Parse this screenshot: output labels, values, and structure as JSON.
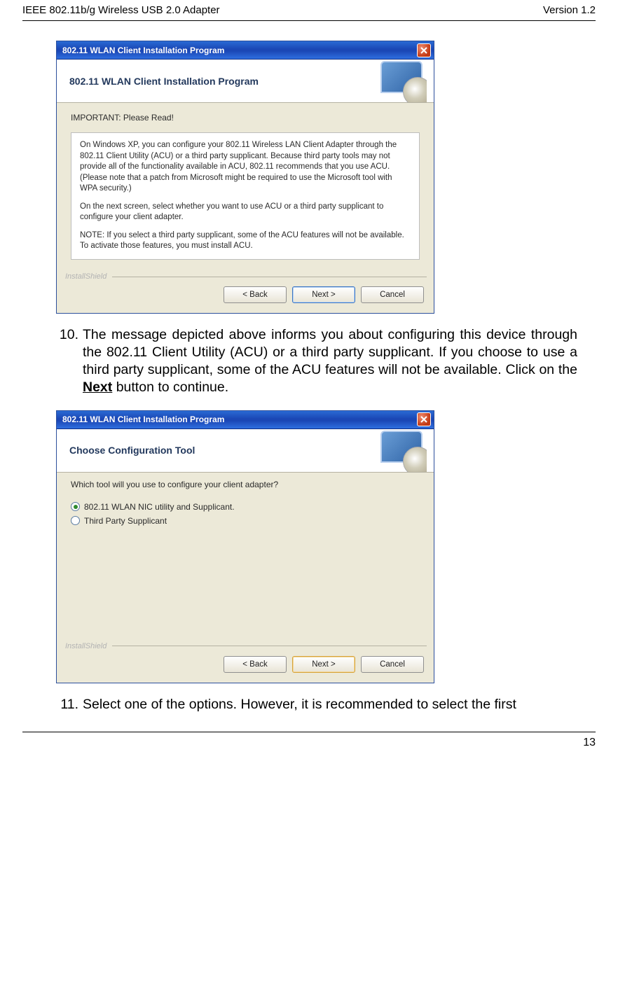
{
  "header": {
    "left": "IEEE 802.11b/g Wireless USB 2.0 Adapter",
    "right": "Version 1.2"
  },
  "dialog1": {
    "titlebar": "802.11 WLAN Client Installation Program",
    "banner_title": "802.11 WLAN Client Installation Program",
    "subtitle": "IMPORTANT: Please Read!",
    "para1": "On Windows XP, you can configure your 802.11 Wireless LAN Client Adapter through the 802.11 Client Utility (ACU) or a third party supplicant. Because third party tools may not provide all of the functionality available in ACU, 802.11 recommends that you use ACU. (Please note that a patch from Microsoft might be required to use the Microsoft tool with WPA security.)",
    "para2": "On the next screen, select whether you want to use ACU or a third party supplicant to configure your client adapter.",
    "para3": "NOTE: If you select a third party supplicant, some of the ACU features will not be available. To activate those features, you must install ACU.",
    "installshield": "InstallShield",
    "buttons": {
      "back": "< Back",
      "next": "Next >",
      "cancel": "Cancel"
    }
  },
  "step10": {
    "num": "10.",
    "text_a": "The message depicted above informs you about configuring this device through the 802.11 Client Utility (ACU) or a third party supplicant.  If you choose to use a third party supplicant, some of the ACU features will not be available. Click on the ",
    "bold": "Next",
    "text_b": " button to continue."
  },
  "dialog2": {
    "titlebar": "802.11 WLAN Client Installation Program",
    "banner_title": "Choose Configuration Tool",
    "question": "Which tool will you use to configure your client adapter?",
    "option1": "802.11 WLAN NIC utility and Supplicant.",
    "option2": "Third Party Supplicant",
    "installshield": "InstallShield",
    "buttons": {
      "back": "< Back",
      "next": "Next >",
      "cancel": "Cancel"
    }
  },
  "step11": {
    "num": "11.",
    "text": "Select one of the options. However, it is recommended to select the first"
  },
  "footer": {
    "page": "13"
  }
}
